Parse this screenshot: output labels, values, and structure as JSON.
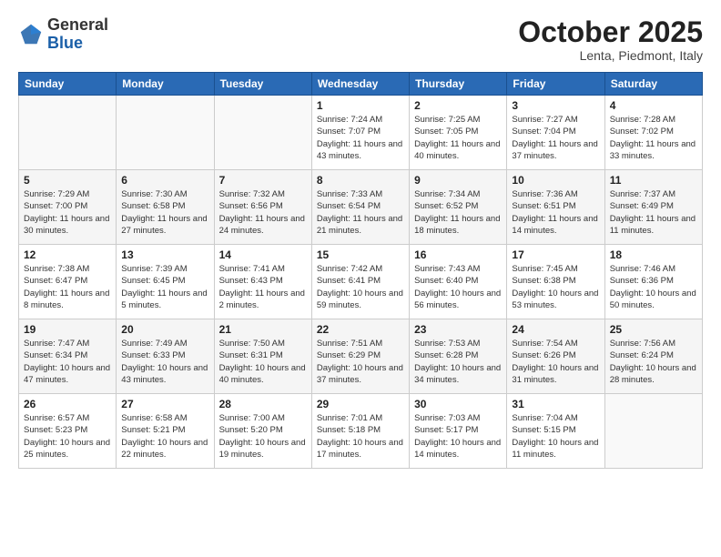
{
  "header": {
    "logo": {
      "general": "General",
      "blue": "Blue"
    },
    "title": "October 2025",
    "location": "Lenta, Piedmont, Italy"
  },
  "days_of_week": [
    "Sunday",
    "Monday",
    "Tuesday",
    "Wednesday",
    "Thursday",
    "Friday",
    "Saturday"
  ],
  "weeks": [
    [
      {
        "day": "",
        "info": ""
      },
      {
        "day": "",
        "info": ""
      },
      {
        "day": "",
        "info": ""
      },
      {
        "day": "1",
        "info": "Sunrise: 7:24 AM\nSunset: 7:07 PM\nDaylight: 11 hours\nand 43 minutes."
      },
      {
        "day": "2",
        "info": "Sunrise: 7:25 AM\nSunset: 7:05 PM\nDaylight: 11 hours\nand 40 minutes."
      },
      {
        "day": "3",
        "info": "Sunrise: 7:27 AM\nSunset: 7:04 PM\nDaylight: 11 hours\nand 37 minutes."
      },
      {
        "day": "4",
        "info": "Sunrise: 7:28 AM\nSunset: 7:02 PM\nDaylight: 11 hours\nand 33 minutes."
      }
    ],
    [
      {
        "day": "5",
        "info": "Sunrise: 7:29 AM\nSunset: 7:00 PM\nDaylight: 11 hours\nand 30 minutes."
      },
      {
        "day": "6",
        "info": "Sunrise: 7:30 AM\nSunset: 6:58 PM\nDaylight: 11 hours\nand 27 minutes."
      },
      {
        "day": "7",
        "info": "Sunrise: 7:32 AM\nSunset: 6:56 PM\nDaylight: 11 hours\nand 24 minutes."
      },
      {
        "day": "8",
        "info": "Sunrise: 7:33 AM\nSunset: 6:54 PM\nDaylight: 11 hours\nand 21 minutes."
      },
      {
        "day": "9",
        "info": "Sunrise: 7:34 AM\nSunset: 6:52 PM\nDaylight: 11 hours\nand 18 minutes."
      },
      {
        "day": "10",
        "info": "Sunrise: 7:36 AM\nSunset: 6:51 PM\nDaylight: 11 hours\nand 14 minutes."
      },
      {
        "day": "11",
        "info": "Sunrise: 7:37 AM\nSunset: 6:49 PM\nDaylight: 11 hours\nand 11 minutes."
      }
    ],
    [
      {
        "day": "12",
        "info": "Sunrise: 7:38 AM\nSunset: 6:47 PM\nDaylight: 11 hours\nand 8 minutes."
      },
      {
        "day": "13",
        "info": "Sunrise: 7:39 AM\nSunset: 6:45 PM\nDaylight: 11 hours\nand 5 minutes."
      },
      {
        "day": "14",
        "info": "Sunrise: 7:41 AM\nSunset: 6:43 PM\nDaylight: 11 hours\nand 2 minutes."
      },
      {
        "day": "15",
        "info": "Sunrise: 7:42 AM\nSunset: 6:41 PM\nDaylight: 10 hours\nand 59 minutes."
      },
      {
        "day": "16",
        "info": "Sunrise: 7:43 AM\nSunset: 6:40 PM\nDaylight: 10 hours\nand 56 minutes."
      },
      {
        "day": "17",
        "info": "Sunrise: 7:45 AM\nSunset: 6:38 PM\nDaylight: 10 hours\nand 53 minutes."
      },
      {
        "day": "18",
        "info": "Sunrise: 7:46 AM\nSunset: 6:36 PM\nDaylight: 10 hours\nand 50 minutes."
      }
    ],
    [
      {
        "day": "19",
        "info": "Sunrise: 7:47 AM\nSunset: 6:34 PM\nDaylight: 10 hours\nand 47 minutes."
      },
      {
        "day": "20",
        "info": "Sunrise: 7:49 AM\nSunset: 6:33 PM\nDaylight: 10 hours\nand 43 minutes."
      },
      {
        "day": "21",
        "info": "Sunrise: 7:50 AM\nSunset: 6:31 PM\nDaylight: 10 hours\nand 40 minutes."
      },
      {
        "day": "22",
        "info": "Sunrise: 7:51 AM\nSunset: 6:29 PM\nDaylight: 10 hours\nand 37 minutes."
      },
      {
        "day": "23",
        "info": "Sunrise: 7:53 AM\nSunset: 6:28 PM\nDaylight: 10 hours\nand 34 minutes."
      },
      {
        "day": "24",
        "info": "Sunrise: 7:54 AM\nSunset: 6:26 PM\nDaylight: 10 hours\nand 31 minutes."
      },
      {
        "day": "25",
        "info": "Sunrise: 7:56 AM\nSunset: 6:24 PM\nDaylight: 10 hours\nand 28 minutes."
      }
    ],
    [
      {
        "day": "26",
        "info": "Sunrise: 6:57 AM\nSunset: 5:23 PM\nDaylight: 10 hours\nand 25 minutes."
      },
      {
        "day": "27",
        "info": "Sunrise: 6:58 AM\nSunset: 5:21 PM\nDaylight: 10 hours\nand 22 minutes."
      },
      {
        "day": "28",
        "info": "Sunrise: 7:00 AM\nSunset: 5:20 PM\nDaylight: 10 hours\nand 19 minutes."
      },
      {
        "day": "29",
        "info": "Sunrise: 7:01 AM\nSunset: 5:18 PM\nDaylight: 10 hours\nand 17 minutes."
      },
      {
        "day": "30",
        "info": "Sunrise: 7:03 AM\nSunset: 5:17 PM\nDaylight: 10 hours\nand 14 minutes."
      },
      {
        "day": "31",
        "info": "Sunrise: 7:04 AM\nSunset: 5:15 PM\nDaylight: 10 hours\nand 11 minutes."
      },
      {
        "day": "",
        "info": ""
      }
    ]
  ]
}
